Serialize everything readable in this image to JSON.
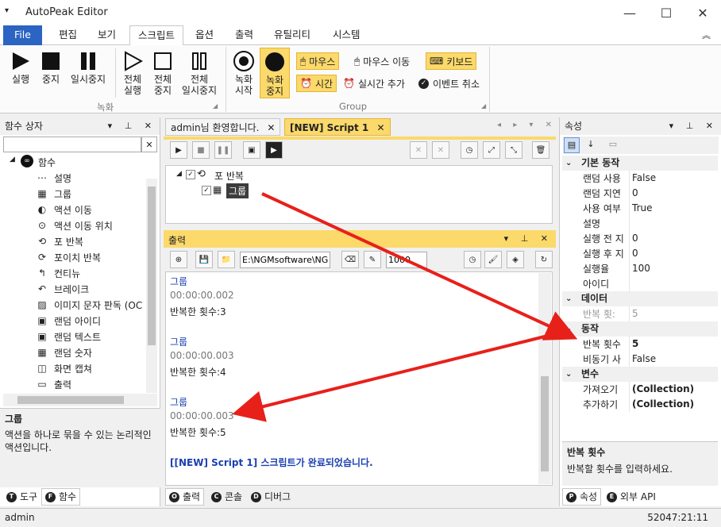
{
  "window": {
    "title": "AutoPeak Editor"
  },
  "menu": {
    "file": "File",
    "tabs": [
      "편집",
      "보기",
      "스크립트",
      "옵션",
      "출력",
      "유틸리티",
      "시스템"
    ]
  },
  "ribbon": {
    "record": {
      "run": "실행",
      "stop": "중지",
      "pause": "일시중지",
      "run_all": "전체\n실행",
      "stop_all": "전체\n중지",
      "pause_all": "전체\n일시중지",
      "group": "녹화"
    },
    "group2": {
      "rec_start": "녹화\n시작",
      "rec_stop": "녹화\n중지",
      "mouse": "마우스",
      "mouse_move": "마우스 이동",
      "keyboard": "키보드",
      "time": "시간",
      "realtime_add": "실시간 추가",
      "event_cancel": "이벤트 취소",
      "group": "Group"
    }
  },
  "func_panel": {
    "title": "함수 상자",
    "root": "함수",
    "items": [
      "설명",
      "그룹",
      "액션 이동",
      "액션 이동 위치",
      "포 반복",
      "포이치 반복",
      "컨티뉴",
      "브레이크",
      "이미지 문자 판독 (OC",
      "랜덤 아이디",
      "랜덤 텍스트",
      "랜덤 숫자",
      "화면 캡쳐",
      "출력"
    ],
    "desc_title": "그룹",
    "desc_text": "액션을 하나로 묶을 수 있는 논리적인 액션입니다.",
    "tabs": [
      "도구",
      "함수"
    ]
  },
  "editor": {
    "tabs": [
      "admin님 환영합니다.",
      "[NEW] Script 1"
    ],
    "tree_loop": "포 반복",
    "tree_group": "그룹"
  },
  "output_panel": {
    "title": "출력",
    "path": "E:\\NGMsoftware\\NG",
    "number": "1000",
    "lines": [
      {
        "t": "그룹",
        "c": "blue"
      },
      {
        "t": "00:00:00.002",
        "c": "gray"
      },
      {
        "t": "반복한 횟수:3",
        "c": "black"
      },
      {
        "t": "",
        "c": "black"
      },
      {
        "t": "그룹",
        "c": "blue"
      },
      {
        "t": "00:00:00.003",
        "c": "gray"
      },
      {
        "t": "반복한 횟수:4",
        "c": "black"
      },
      {
        "t": "",
        "c": "black"
      },
      {
        "t": "그룹",
        "c": "blue"
      },
      {
        "t": "00:00:00.003",
        "c": "gray"
      },
      {
        "t": "반복한 횟수:5",
        "c": "black"
      },
      {
        "t": "",
        "c": "black"
      },
      {
        "t": "[[NEW] Script 1] 스크립트가 완료되었습니다.",
        "c": "blue"
      }
    ],
    "tabs": [
      "출력",
      "콘솔",
      "디버그"
    ]
  },
  "properties": {
    "title": "속성",
    "categories": [
      {
        "name": "기본 동작",
        "rows": [
          [
            "랜덤 사용",
            "False"
          ],
          [
            "랜덤 지연",
            "0"
          ],
          [
            "사용 여부",
            "True"
          ],
          [
            "설명",
            ""
          ],
          [
            "실행 전 지",
            "0"
          ],
          [
            "실행 후 지",
            "0"
          ],
          [
            "실행율",
            "100"
          ],
          [
            "아이디",
            ""
          ]
        ]
      },
      {
        "name": "데이터",
        "rows": [
          [
            "반복 횟:",
            "5"
          ]
        ]
      },
      {
        "name": "동작",
        "rows": [
          [
            "반복 횟수",
            "5"
          ],
          [
            "비동기 사",
            "False"
          ]
        ]
      },
      {
        "name": "변수",
        "rows": [
          [
            "가져오기",
            "(Collection)"
          ],
          [
            "추가하기",
            "(Collection)"
          ]
        ]
      }
    ],
    "desc_title": "반복 횟수",
    "desc_text": "반복할 횟수를 입력하세요.",
    "tabs": [
      "속성",
      "외부 API"
    ]
  },
  "status": {
    "user": "admin",
    "clock": "52047:21:11"
  },
  "colors": {
    "accent": "#2b64c2",
    "highlight": "#fbd96a",
    "arrow": "#e8201a",
    "log_blue": "#1b3fb0"
  }
}
